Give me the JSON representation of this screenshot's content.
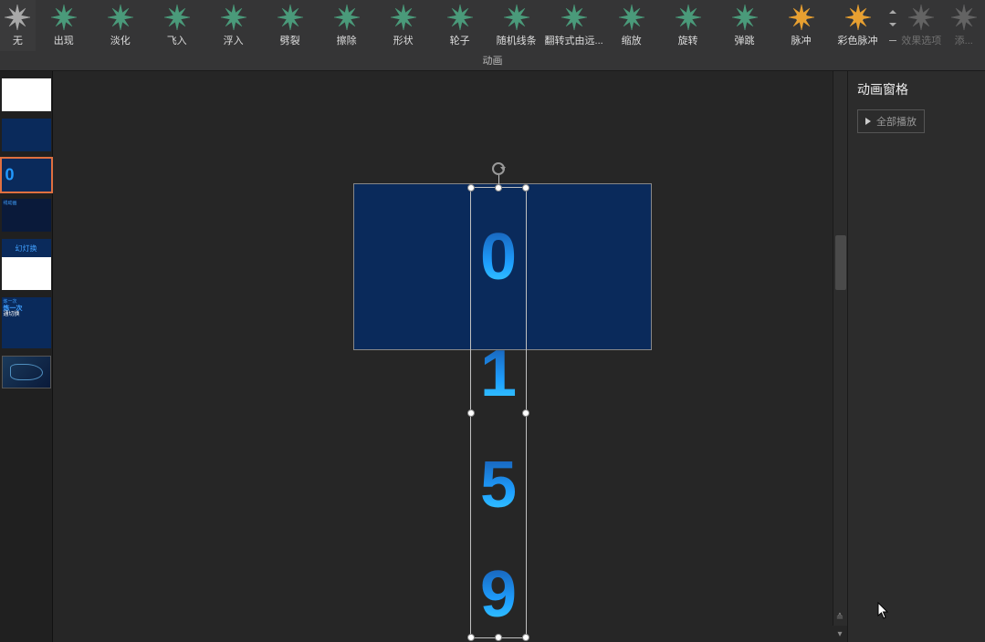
{
  "ribbon": {
    "group_label": "动画",
    "items": [
      {
        "label": "无",
        "color": "gray",
        "glowClass": "first"
      },
      {
        "label": "出现",
        "color": "green"
      },
      {
        "label": "淡化",
        "color": "green"
      },
      {
        "label": "飞入",
        "color": "green"
      },
      {
        "label": "浮入",
        "color": "green"
      },
      {
        "label": "劈裂",
        "color": "green"
      },
      {
        "label": "擦除",
        "color": "green"
      },
      {
        "label": "形状",
        "color": "green"
      },
      {
        "label": "轮子",
        "color": "green"
      },
      {
        "label": "随机线条",
        "color": "green"
      },
      {
        "label": "翻转式由远...",
        "color": "green"
      },
      {
        "label": "缩放",
        "color": "green"
      },
      {
        "label": "旋转",
        "color": "green"
      },
      {
        "label": "弹跳",
        "color": "green"
      },
      {
        "label": "脉冲",
        "color": "orange",
        "glow": true
      },
      {
        "label": "彩色脉冲",
        "color": "orange",
        "glow": true
      }
    ],
    "disabled_items": [
      {
        "label": "效果选项"
      },
      {
        "label": "添..."
      }
    ]
  },
  "anim_pane": {
    "title": "动画窗格",
    "play_all": "全部播放"
  },
  "thumbnails": {
    "slide3_zero": "0",
    "slide5_text": "幻灯换"
  },
  "digits": {
    "d0": "0",
    "d1": "1",
    "d5": "5",
    "d9": "9"
  }
}
